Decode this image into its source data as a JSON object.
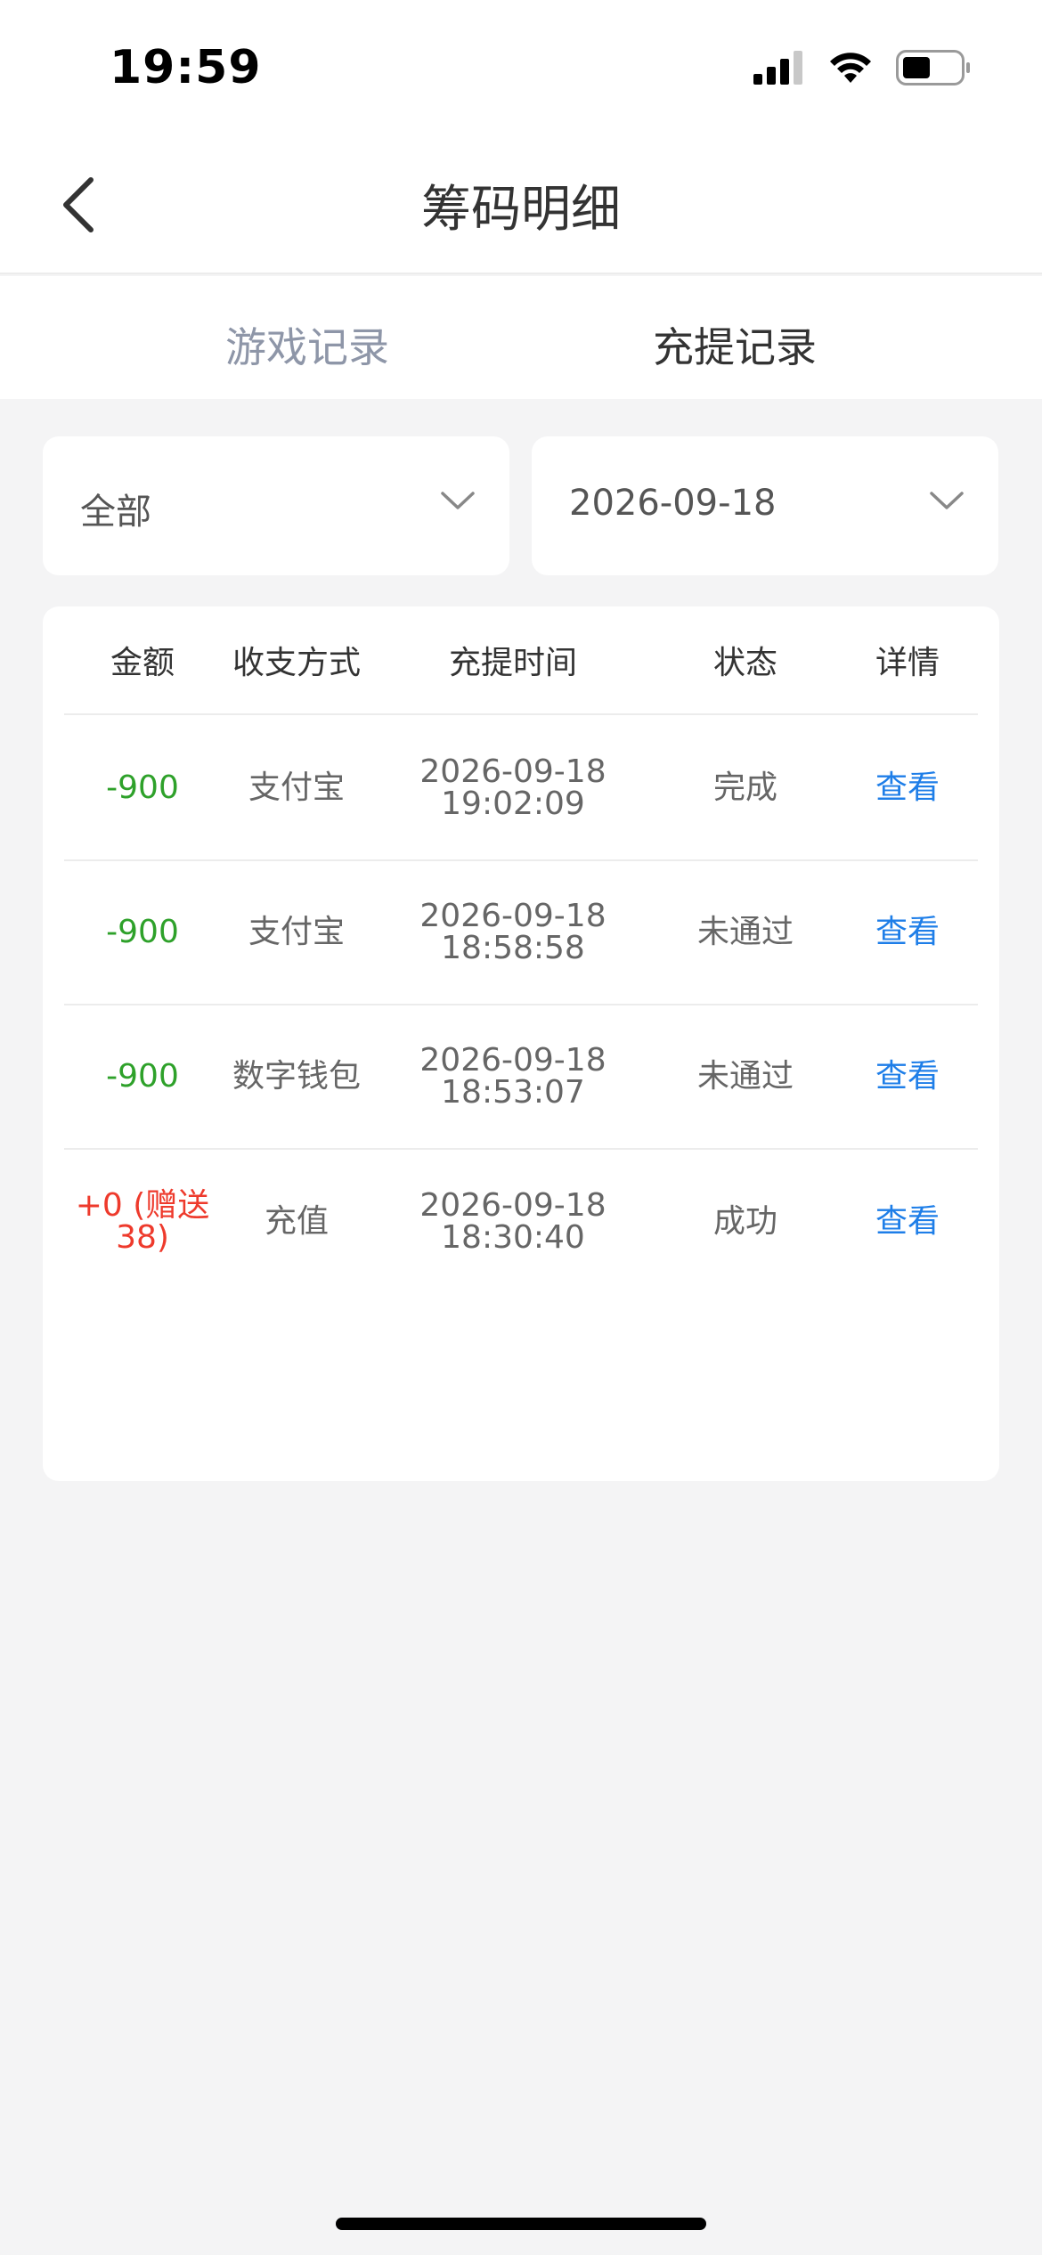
{
  "status_bar": {
    "time": "19:59",
    "icons": [
      "signal-icon",
      "wifi-icon",
      "battery-icon"
    ]
  },
  "nav": {
    "title": "筹码明细",
    "back_icon": "chevron-left-icon"
  },
  "tabs": [
    {
      "label": "游戏记录",
      "active": false
    },
    {
      "label": "充提记录",
      "active": true
    }
  ],
  "filters": {
    "type": "全部",
    "date": "2026-09-18"
  },
  "table": {
    "headers": [
      "金额",
      "收支方式",
      "充提时间",
      "状态",
      "详情"
    ],
    "rows": [
      {
        "amount": "-900",
        "method": "支付宝",
        "date": "2026-09-18",
        "time": "19:02:09",
        "status": "完成",
        "detail": "查看"
      },
      {
        "amount": "-900",
        "method": "支付宝",
        "date": "2026-09-18",
        "time": "18:58:58",
        "status": "未通过",
        "detail": "查看"
      },
      {
        "amount": "-900",
        "method": "数字钱包",
        "date": "2026-09-18",
        "time": "18:53:07",
        "status": "未通过",
        "detail": "查看"
      },
      {
        "amount_line1": "+0 (赠送",
        "amount_line2": "38)",
        "method": "充值",
        "date": "2026-09-18",
        "time": "18:30:40",
        "status": "成功",
        "detail": "查看"
      }
    ]
  },
  "colors": {
    "negative": "#2ea12a",
    "positive": "#ee3a2c",
    "link": "#1e7ee8",
    "inactive_tab": "#8e96a8"
  }
}
